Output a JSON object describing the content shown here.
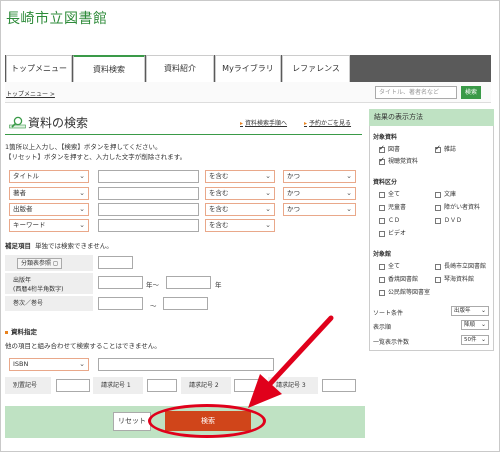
{
  "site": {
    "title": "長崎市立図書館"
  },
  "nav": {
    "tabs": [
      "トップメニュー",
      "資料検索",
      "資料紹介",
      "Myライブラリ",
      "レファレンス"
    ],
    "active_index": 1
  },
  "top_search": {
    "placeholder": "タイトル、著者名など",
    "button": "検索"
  },
  "breadcrumb": "トップメニュー >",
  "main": {
    "title": "資料の検索",
    "links": [
      "資料検索手順へ",
      "予約かごを見る"
    ],
    "help_line1": "1箇所以上入力し、【検索】ボタンを押してください。",
    "help_line2": "【リセット】ボタンを押すと、入力した文字が削除されます。"
  },
  "criteria_rows": [
    {
      "field": "タイトル",
      "match": "を含む",
      "conj": "かつ"
    },
    {
      "field": "著者",
      "match": "を含む",
      "conj": "かつ"
    },
    {
      "field": "出版者",
      "match": "を含む",
      "conj": "かつ"
    },
    {
      "field": "キーワード",
      "match": "を含む",
      "conj": ""
    }
  ],
  "supplement": {
    "heading": "補足項目",
    "note": "単独では検索できません。",
    "class_label": "分類表参照",
    "year_label_1": "出版年",
    "year_label_2": "(西暦4桁半角数字)",
    "year_from_suffix": "年～",
    "year_to_suffix": "年",
    "volume_label": "巻次／巻号",
    "range_sep": "～"
  },
  "material_spec": {
    "heading": "資料指定",
    "note": "他の項目と組み合わせて検索することはできません。",
    "type_value": "ISBN",
    "labels": [
      "別置記号",
      "請求記号 1",
      "請求記号 2",
      "請求記号 3"
    ]
  },
  "footer": {
    "reset": "リセット",
    "search": "検索"
  },
  "sidebar": {
    "title": "結果の表示方法",
    "target_label": "対象資料",
    "target_items": [
      {
        "label": "図書",
        "checked": true
      },
      {
        "label": "雑誌",
        "checked": true
      },
      {
        "label": "視聴覚資料",
        "checked": true
      }
    ],
    "category_label": "資料区分",
    "category_items": [
      "全て",
      "文庫",
      "児童書",
      "障がい者資料",
      "ＣＤ",
      "ＤＶＤ",
      "ビデオ"
    ],
    "library_label": "対象館",
    "library_items": [
      "全て",
      "長崎市立図書館",
      "香焼図書館",
      "琴海資料館",
      "公民館等図書室"
    ],
    "sort_label": "ソート条件",
    "sort_value": "出版年",
    "order_label": "表示順",
    "order_value": "降順",
    "count_label": "一覧表示件数",
    "count_value": "50件"
  },
  "colors": {
    "brand_green": "#3a9a48",
    "search_button": "#d0451a",
    "highlight_oval": "#e0001b"
  }
}
